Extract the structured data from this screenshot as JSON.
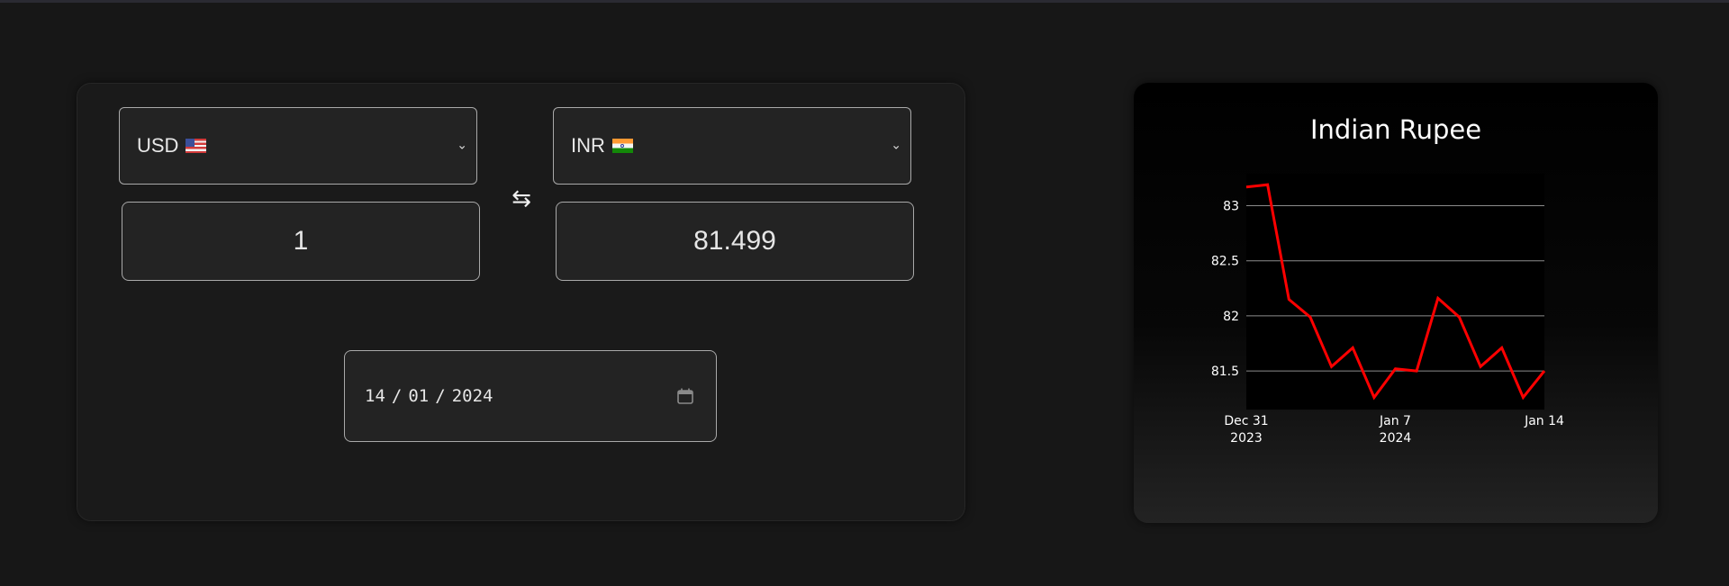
{
  "converter": {
    "from": {
      "code": "USD",
      "flag": "us-flag-icon",
      "amount": "1"
    },
    "to": {
      "code": "INR",
      "flag": "india-flag-icon",
      "amount": "81.499"
    },
    "swap_icon": "swap-arrows-icon",
    "date": {
      "day": "14",
      "month": "01",
      "year": "2024",
      "sep": "/",
      "icon": "calendar-icon"
    }
  },
  "chart_data": {
    "type": "line",
    "title": "Indian Rupee",
    "x_ticks": [
      {
        "date": "2023-12-31",
        "line1": "Dec 31",
        "line2": "2023"
      },
      {
        "date": "2024-01-07",
        "line1": "Jan 7",
        "line2": "2024"
      },
      {
        "date": "2024-01-14",
        "line1": "Jan 14",
        "line2": ""
      }
    ],
    "y_ticks": [
      "81.5",
      "82",
      "82.5",
      "83"
    ],
    "xlim": [
      "2023-12-31",
      "2024-01-14"
    ],
    "ylim": [
      81.15,
      83.29
    ],
    "grid": "horizontal",
    "series": [
      {
        "color": "#ff0000",
        "x": [
          "2023-12-31",
          "2024-01-01",
          "2024-01-02",
          "2024-01-03",
          "2024-01-04",
          "2024-01-05",
          "2024-01-06",
          "2024-01-07",
          "2024-01-08",
          "2024-01-09",
          "2024-01-10",
          "2024-01-11",
          "2024-01-12",
          "2024-01-13",
          "2024-01-14"
        ],
        "y": [
          83.17,
          83.19,
          82.15,
          81.99,
          81.54,
          81.71,
          81.26,
          81.52,
          81.5,
          82.16,
          81.99,
          81.54,
          81.71,
          81.26,
          81.5
        ]
      }
    ]
  }
}
